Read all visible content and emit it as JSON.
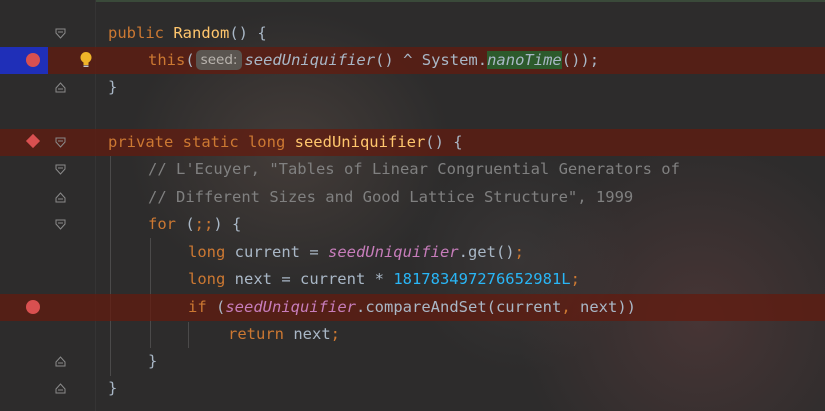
{
  "editor": {
    "lines": [
      {
        "t": "public Random() {"
      },
      {
        "this_kw": "this",
        "open_paren": "(",
        "hint": "seed:",
        "method": "seedUniquifier",
        "mid": "() ^ System.",
        "nano": "nanoTime",
        "end": "());"
      },
      {
        "t": "}"
      },
      {
        "t": ""
      },
      {
        "kw": "private static long ",
        "fn": "seedUniquifier",
        "rest": "() {"
      },
      {
        "t": "// L'Ecuyer, \"Tables of Linear Congruential Generators of"
      },
      {
        "t": "// Different Sizes and Good Lattice Structure\", 1999"
      },
      {
        "kw": "for",
        "rest1": " (",
        "semi": ";;",
        "rest2": ") {"
      },
      {
        "kw": "long",
        "rest1": " current = ",
        "stat": "seedUniquifier",
        "rest2": ".get()",
        "semi": ";"
      },
      {
        "kw": "long",
        "rest1": " next = current * ",
        "num": "181783497276652981L",
        "semi": ";"
      },
      {
        "kw": "if",
        "rest1": " (",
        "stat": "seedUniquifier",
        "rest2": ".compareAndSet(current",
        "comma": ",",
        "rest3": " next))"
      },
      {
        "kw": "return",
        "rest1": " next",
        "semi": ";"
      },
      {
        "t": "}"
      },
      {
        "t": "}"
      }
    ]
  }
}
